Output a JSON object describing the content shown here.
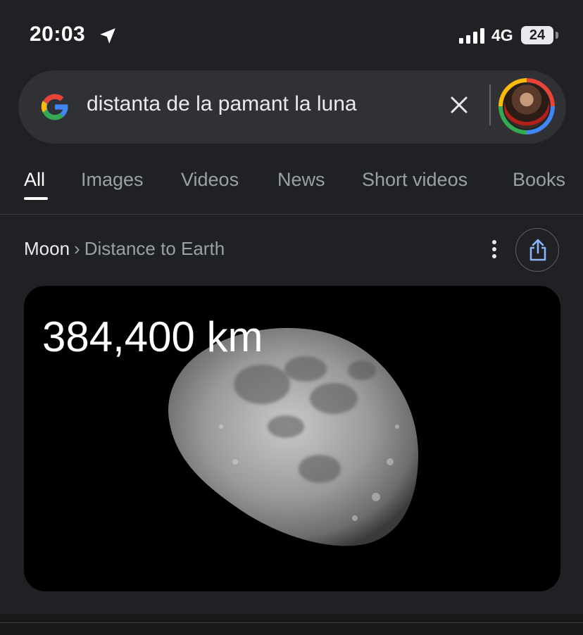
{
  "status_bar": {
    "time": "20:03",
    "network": "4G",
    "battery": "24",
    "icons": [
      "location-arrow-icon",
      "signal-bars-icon",
      "battery-icon"
    ]
  },
  "search": {
    "query": "distanta de la pamant la luna",
    "icons": [
      "google-g-icon",
      "clear-icon",
      "avatar"
    ]
  },
  "tabs": [
    {
      "label": "All",
      "active": true
    },
    {
      "label": "Images"
    },
    {
      "label": "Videos"
    },
    {
      "label": "News"
    },
    {
      "label": "Short videos"
    },
    {
      "label": "Books"
    }
  ],
  "result": {
    "breadcrumb_root": "Moon",
    "breadcrumb_separator": "›",
    "breadcrumb_leaf": "Distance to Earth",
    "value": "384,400 km",
    "icons": [
      "more-vert-icon",
      "share-icon",
      "moon-image"
    ]
  },
  "colors": {
    "background": "#202124",
    "search_bg": "#303134",
    "text_primary": "#e8eaed",
    "text_secondary": "#9aa0a6",
    "accent": "#8ab4f8"
  }
}
